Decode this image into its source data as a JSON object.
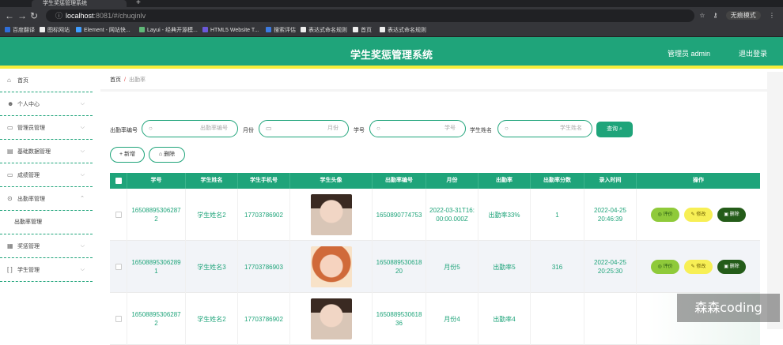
{
  "browser": {
    "tab_title": "学生奖惩管理系统",
    "url_host": "localhost",
    "url_path": ":8081/#/chuqinlv",
    "profile": "无痕模式",
    "bookmarks": [
      {
        "label": "百度翻译",
        "color": "#2f6fd9"
      },
      {
        "label": "图标网站",
        "color": "#eeeeee"
      },
      {
        "label": "Element - 网站快...",
        "color": "#409eff"
      },
      {
        "label": "Layui - 经典开源模...",
        "color": "#5fb878"
      },
      {
        "label": "HTML5 Website T...",
        "color": "#6b58d8"
      },
      {
        "label": "搜索评估",
        "color": "#3d7be0"
      },
      {
        "label": "表达式命名规则",
        "color": "#eeeeee"
      },
      {
        "label": "首页",
        "color": "#eeeeee"
      },
      {
        "label": "表达式命名规则",
        "color": "#eeeeee"
      }
    ]
  },
  "header": {
    "title": "学生奖惩管理系统",
    "user": "管理员 admin",
    "logout": "退出登录"
  },
  "sidebar": {
    "items": [
      {
        "label": "首页",
        "icon": "home-icon",
        "glyph": "⌂"
      },
      {
        "label": "个人中心",
        "icon": "user-icon",
        "glyph": "☻"
      },
      {
        "label": "管理员管理",
        "icon": "message-icon",
        "glyph": "▭"
      },
      {
        "label": "基础数据管理",
        "icon": "table-icon",
        "glyph": "▤"
      },
      {
        "label": "成绩管理",
        "icon": "folder-icon",
        "glyph": "▭"
      },
      {
        "label": "出勤率管理",
        "icon": "help-icon",
        "glyph": "⊙"
      },
      {
        "label": "出勤率管理",
        "icon": "",
        "glyph": ""
      },
      {
        "label": "奖惩管理",
        "icon": "print-icon",
        "glyph": "▦"
      },
      {
        "label": "学生管理",
        "icon": "bracket-icon",
        "glyph": "[ ]"
      }
    ]
  },
  "breadcrumb": {
    "home": "首页",
    "sep": "/",
    "current": "出勤率"
  },
  "filters": {
    "f1_label": "出勤率编号",
    "f1_placeholder": "出勤率编号",
    "f2_label": "月份",
    "f2_placeholder": "月份",
    "f3_label": "学号",
    "f3_placeholder": "学号",
    "f4_label": "学生姓名",
    "f4_placeholder": "学生姓名",
    "search": "查询"
  },
  "actions": {
    "add": "新增",
    "delete": "删除"
  },
  "table": {
    "headers": [
      "学号",
      "学生姓名",
      "学生手机号",
      "学生头像",
      "出勤率编号",
      "月份",
      "出勤率",
      "出勤率分数",
      "录入时间",
      "操作"
    ],
    "rows": [
      {
        "xuehao": "165088953062872",
        "name": "学生姓名2",
        "phone": "17703786902",
        "code": "1650890774753",
        "month": "2022-03-31T16:00:00.000Z",
        "rate": "出勤率33%",
        "score": "1",
        "time": "2022-04-25 20:46:39"
      },
      {
        "xuehao": "165088953062891",
        "name": "学生姓名3",
        "phone": "17703786903",
        "code": "165088953061820",
        "month": "月份5",
        "rate": "出勤率5",
        "score": "316",
        "time": "2022-04-25 20:25:30"
      },
      {
        "xuehao": "165088953062872",
        "name": "学生姓名2",
        "phone": "17703786902",
        "code": "165088953061836",
        "month": "月份4",
        "rate": "出勤率4",
        "score": "",
        "time": ""
      }
    ],
    "ops": {
      "eval": "评价",
      "edit": "修改",
      "del": "删除"
    }
  },
  "watermark": "森森coding"
}
